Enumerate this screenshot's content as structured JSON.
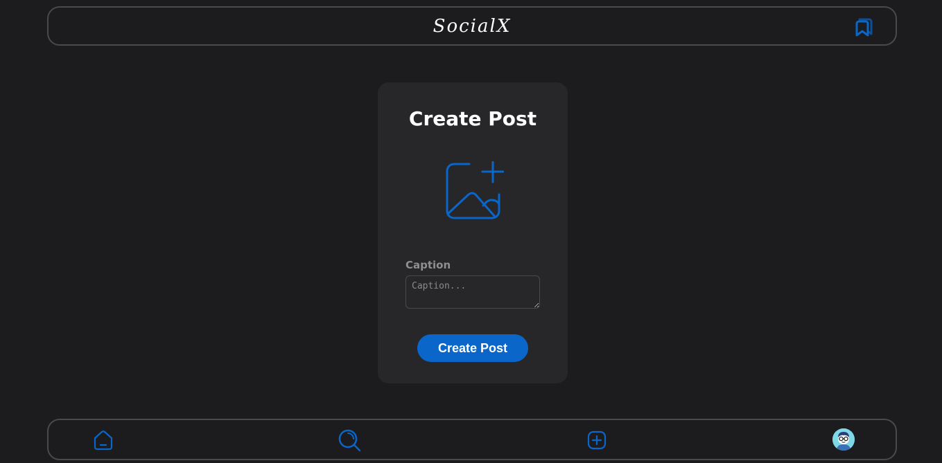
{
  "header": {
    "logo": "SocialX",
    "bookmarks_icon": "bookmarks-icon"
  },
  "create_post": {
    "title": "Create Post",
    "upload_icon": "add-image-icon",
    "caption_label": "Caption",
    "caption_placeholder": "Caption...",
    "caption_value": "",
    "submit_label": "Create Post"
  },
  "bottom_nav": {
    "items": [
      {
        "name": "home",
        "icon": "home-icon"
      },
      {
        "name": "search",
        "icon": "search-icon"
      },
      {
        "name": "create",
        "icon": "add-square-icon"
      },
      {
        "name": "profile",
        "icon": "avatar"
      }
    ]
  },
  "colors": {
    "background": "#1c1c1e",
    "card": "#27272a",
    "accent": "#0a66c9",
    "border": "#4a4a4d",
    "muted_text": "#8e8e93"
  }
}
